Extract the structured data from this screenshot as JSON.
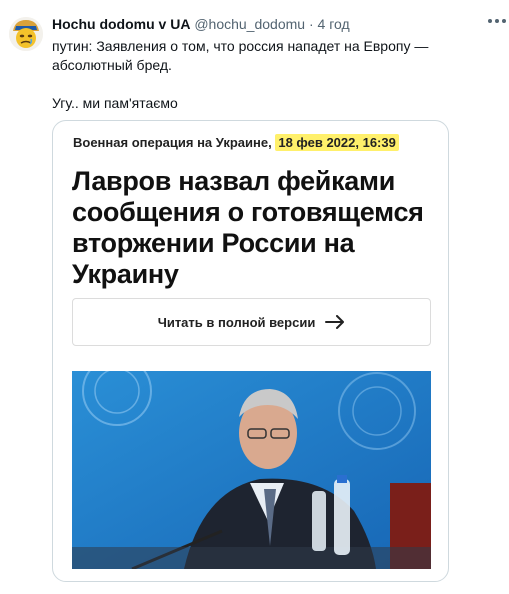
{
  "tweet": {
    "author_name": "Hochu dodomu v UA",
    "author_handle": "@hochu_dodomu",
    "separator": "·",
    "time": "4 год",
    "text_line1": "путин: Заявления о том, что россия нападет на Европу — абсолютный бред.",
    "text_line2": "Угу.. ми пам'ятаємо"
  },
  "card": {
    "rubric": "Военная операция на Украине",
    "date": "18 фев 2022, 16:39",
    "headline": "Лавров назвал фейками сообщения о готовящемся вторжении России на Украину",
    "read_button": "Читать в полной версии",
    "photo_icon": "portrait-photo"
  },
  "colors": {
    "text": "#0f1419",
    "secondary": "#536471",
    "highlight": "#fff06b",
    "border": "#cfd9de"
  }
}
